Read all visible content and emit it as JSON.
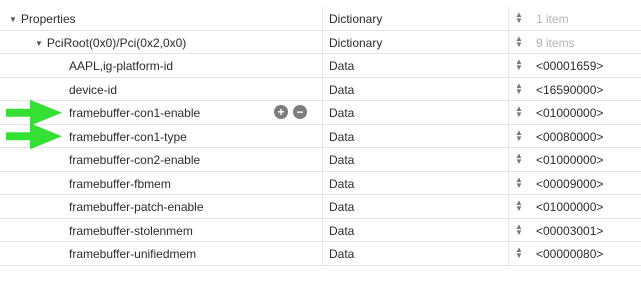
{
  "rows": [
    {
      "key": "Properties",
      "type": "Dictionary",
      "value": "1 item",
      "level": 0,
      "disclosure": "open",
      "value_muted": true
    },
    {
      "key": "PciRoot(0x0)/Pci(0x2,0x0)",
      "type": "Dictionary",
      "value": "9 items",
      "level": 1,
      "disclosure": "open",
      "value_muted": true
    },
    {
      "key": "AAPL,ig-platform-id",
      "type": "Data",
      "value": "<00001659>",
      "level": 2
    },
    {
      "key": "device-id",
      "type": "Data",
      "value": "<16590000>",
      "level": 2
    },
    {
      "key": "framebuffer-con1-enable",
      "type": "Data",
      "value": "<01000000>",
      "level": 2,
      "highlighted": true,
      "has_add_remove": true
    },
    {
      "key": "framebuffer-con1-type",
      "type": "Data",
      "value": "<00080000>",
      "level": 2,
      "highlighted": true
    },
    {
      "key": "framebuffer-con2-enable",
      "type": "Data",
      "value": "<01000000>",
      "level": 2
    },
    {
      "key": "framebuffer-fbmem",
      "type": "Data",
      "value": "<00009000>",
      "level": 2
    },
    {
      "key": "framebuffer-patch-enable",
      "type": "Data",
      "value": "<01000000>",
      "level": 2
    },
    {
      "key": "framebuffer-stolenmem",
      "type": "Data",
      "value": "<00003001>",
      "level": 2
    },
    {
      "key": "framebuffer-unifiedmem",
      "type": "Data",
      "value": "<00000080>",
      "level": 2
    }
  ],
  "colors": {
    "arrow": "#33e033",
    "row_divider": "#e3e3e3",
    "muted_value": "#b4b4b4"
  },
  "icons": {
    "disclosure": "disclosure-triangle-icon",
    "stepper": "stepper-icon",
    "add": "plus-circle-icon",
    "remove": "minus-circle-icon",
    "annotation": "green-arrow-icon"
  }
}
